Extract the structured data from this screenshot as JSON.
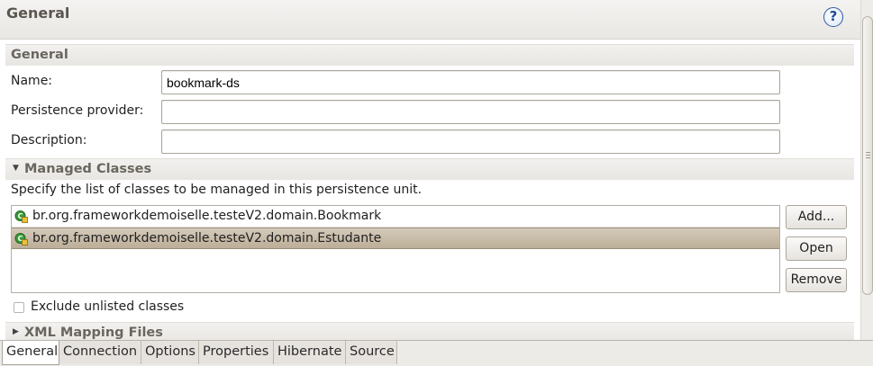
{
  "header": {
    "title": "General",
    "help_icon": "help-icon"
  },
  "general_section": {
    "title": "General",
    "name_label": "Name:",
    "name_value": "bookmark-ds",
    "provider_label": "Persistence provider:",
    "provider_value": "",
    "description_label": "Description:",
    "description_value": ""
  },
  "managed_classes": {
    "title": "Managed Classes",
    "description": "Specify the list of classes to be managed in this persistence unit.",
    "classes": [
      "br.org.frameworkdemoiselle.testeV2.domain.Bookmark",
      "br.org.frameworkdemoiselle.testeV2.domain.Estudante"
    ],
    "selected_index": 1,
    "add_label": "Add...",
    "open_label": "Open",
    "remove_label": "Remove",
    "exclude_label": "Exclude unlisted classes",
    "exclude_checked": false
  },
  "xml_mapping": {
    "title": "XML Mapping Files"
  },
  "tabs": [
    {
      "label": "General",
      "active": true
    },
    {
      "label": "Connection",
      "active": false
    },
    {
      "label": "Options",
      "active": false
    },
    {
      "label": "Properties",
      "active": false
    },
    {
      "label": "Hibernate",
      "active": false
    },
    {
      "label": "Source",
      "active": false
    }
  ],
  "colors": {
    "selection": "#c8bca8",
    "accent": "#2d5aa6"
  }
}
